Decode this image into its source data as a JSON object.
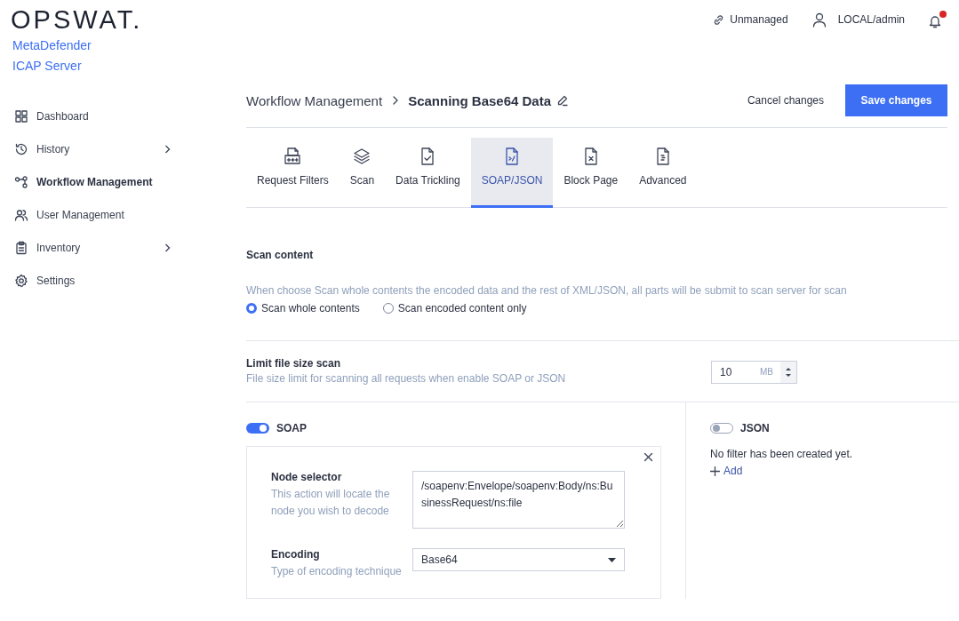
{
  "brand": {
    "logo": "OPSWAT.",
    "product_lines": [
      "MetaDefender",
      "ICAP Server"
    ]
  },
  "top_bar": {
    "status": "Unmanaged",
    "user": "LOCAL/admin",
    "notifications_unread": true
  },
  "sidebar": {
    "items": [
      {
        "label": "Dashboard",
        "selected": false,
        "expandable": false
      },
      {
        "label": "History",
        "selected": false,
        "expandable": true
      },
      {
        "label": "Workflow Management",
        "selected": true,
        "expandable": false
      },
      {
        "label": "User Management",
        "selected": false,
        "expandable": false
      },
      {
        "label": "Inventory",
        "selected": false,
        "expandable": true
      },
      {
        "label": "Settings",
        "selected": false,
        "expandable": false
      }
    ]
  },
  "breadcrumb": {
    "parent": "Workflow Management",
    "current": "Scanning Base64 Data"
  },
  "actions": {
    "cancel": "Cancel changes",
    "save": "Save changes"
  },
  "tabs": [
    {
      "label": "Request Filters",
      "selected": false
    },
    {
      "label": "Scan",
      "selected": false
    },
    {
      "label": "Data Trickling",
      "selected": false
    },
    {
      "label": "SOAP/JSON",
      "selected": true
    },
    {
      "label": "Block Page",
      "selected": false
    },
    {
      "label": "Advanced",
      "selected": false
    }
  ],
  "scan_content": {
    "title": "Scan content",
    "description": "When choose Scan whole contents the encoded data and the rest of XML/JSON, all parts will be submit to scan server for scan",
    "options": [
      {
        "label": "Scan whole contents",
        "selected": true
      },
      {
        "label": "Scan encoded content only",
        "selected": false
      }
    ]
  },
  "limit_file_size": {
    "title": "Limit file size scan",
    "description": "File size limit for scanning all requests when enable SOAP or JSON",
    "value": "10",
    "unit": "MB"
  },
  "soap": {
    "label": "SOAP",
    "on": true,
    "filters": [
      {
        "node_selector": {
          "title": "Node selector",
          "description": "This action will locate the node you wish to decode",
          "value": "/soapenv:Envelope/soapenv:Body/ns:BusinessRequest/ns:file"
        },
        "encoding": {
          "title": "Encoding",
          "description": "Type of encoding technique",
          "value": "Base64"
        }
      }
    ]
  },
  "json": {
    "label": "JSON",
    "on": false,
    "empty_message": "No filter has been created yet.",
    "add": "Add"
  }
}
